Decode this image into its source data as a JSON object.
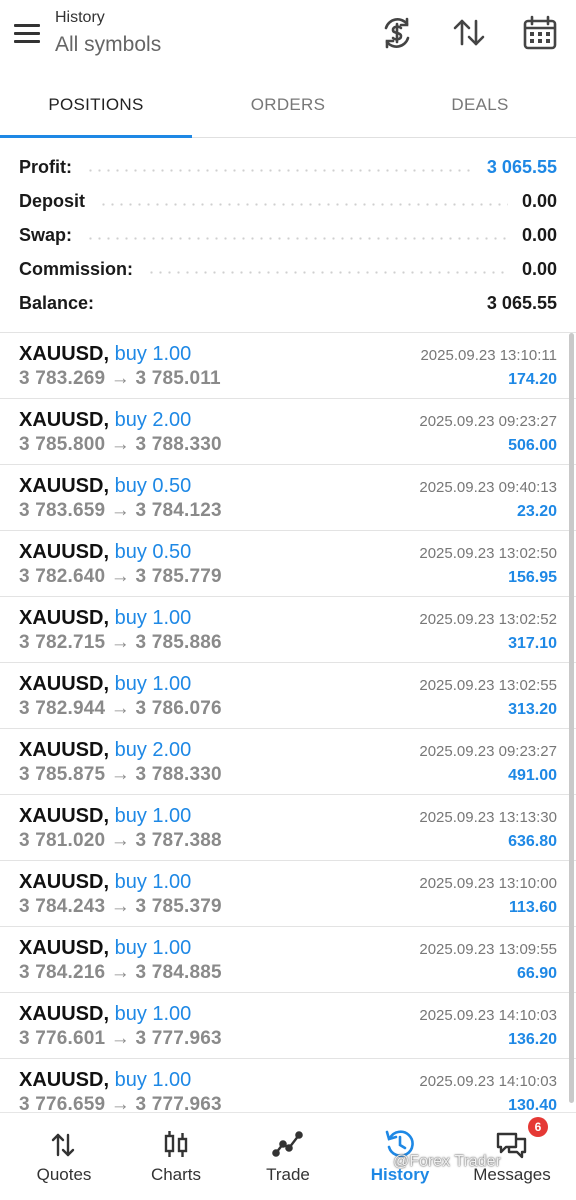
{
  "header": {
    "title": "History",
    "subtitle": "All symbols",
    "icons": [
      "menu-icon",
      "currency-swap-icon",
      "sort-icon",
      "calendar-icon"
    ]
  },
  "tabs": [
    {
      "label": "POSITIONS",
      "active": true
    },
    {
      "label": "ORDERS",
      "active": false
    },
    {
      "label": "DEALS",
      "active": false
    }
  ],
  "summary": {
    "profit": {
      "label": "Profit:",
      "value": "3 065.55"
    },
    "deposit": {
      "label": "Deposit",
      "value": "0.00"
    },
    "swap": {
      "label": "Swap:",
      "value": "0.00"
    },
    "commission": {
      "label": "Commission:",
      "value": "0.00"
    },
    "balance": {
      "label": "Balance:",
      "value": "3 065.55"
    }
  },
  "deals": [
    {
      "symbol": "XAUUSD,",
      "direction": "buy 1.00",
      "prices": "3 783.269 → 3 785.011",
      "time": "2025.09.23 13:10:11",
      "profit": "174.20"
    },
    {
      "symbol": "XAUUSD,",
      "direction": "buy 2.00",
      "prices": "3 785.800 → 3 788.330",
      "time": "2025.09.23 09:23:27",
      "profit": "506.00"
    },
    {
      "symbol": "XAUUSD,",
      "direction": "buy 0.50",
      "prices": "3 783.659 → 3 784.123",
      "time": "2025.09.23 09:40:13",
      "profit": "23.20"
    },
    {
      "symbol": "XAUUSD,",
      "direction": "buy 0.50",
      "prices": "3 782.640 → 3 785.779",
      "time": "2025.09.23 13:02:50",
      "profit": "156.95"
    },
    {
      "symbol": "XAUUSD,",
      "direction": "buy 1.00",
      "prices": "3 782.715 → 3 785.886",
      "time": "2025.09.23 13:02:52",
      "profit": "317.10"
    },
    {
      "symbol": "XAUUSD,",
      "direction": "buy 1.00",
      "prices": "3 782.944 → 3 786.076",
      "time": "2025.09.23 13:02:55",
      "profit": "313.20"
    },
    {
      "symbol": "XAUUSD,",
      "direction": "buy 2.00",
      "prices": "3 785.875 → 3 788.330",
      "time": "2025.09.23 09:23:27",
      "profit": "491.00"
    },
    {
      "symbol": "XAUUSD,",
      "direction": "buy 1.00",
      "prices": "3 781.020 → 3 787.388",
      "time": "2025.09.23 13:13:30",
      "profit": "636.80"
    },
    {
      "symbol": "XAUUSD,",
      "direction": "buy 1.00",
      "prices": "3 784.243 → 3 785.379",
      "time": "2025.09.23 13:10:00",
      "profit": "113.60"
    },
    {
      "symbol": "XAUUSD,",
      "direction": "buy 1.00",
      "prices": "3 784.216 → 3 784.885",
      "time": "2025.09.23 13:09:55",
      "profit": "66.90"
    },
    {
      "symbol": "XAUUSD,",
      "direction": "buy 1.00",
      "prices": "3 776.601 → 3 777.963",
      "time": "2025.09.23 14:10:03",
      "profit": "136.20"
    },
    {
      "symbol": "XAUUSD,",
      "direction": "buy 1.00",
      "prices": "3 776.659 → 3 777.963",
      "time": "2025.09.23 14:10:03",
      "profit": "130.40"
    }
  ],
  "bottom_nav": [
    {
      "label": "Quotes",
      "icon": "quotes-icon",
      "active": false
    },
    {
      "label": "Charts",
      "icon": "charts-icon",
      "active": false
    },
    {
      "label": "Trade",
      "icon": "trade-icon",
      "active": false
    },
    {
      "label": "History",
      "icon": "history-icon",
      "active": true
    },
    {
      "label": "Messages",
      "icon": "messages-icon",
      "active": false,
      "badge": "6"
    }
  ],
  "watermark": "@Forex Trader",
  "colors": {
    "accent": "#1e88e5",
    "badge": "#e53935"
  }
}
